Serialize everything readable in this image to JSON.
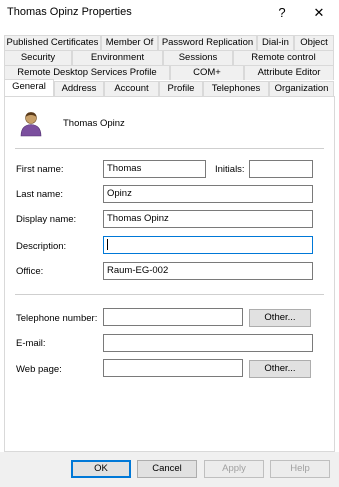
{
  "window": {
    "title": "Thomas Opinz Properties",
    "help_glyph": "?",
    "close_glyph": "✕"
  },
  "tabs": {
    "row1": [
      "Published Certificates",
      "Member Of",
      "Password Replication",
      "Dial-in",
      "Object"
    ],
    "row2": [
      "Security",
      "Environment",
      "Sessions",
      "Remote control"
    ],
    "row3": [
      "Remote Desktop Services Profile",
      "COM+",
      "Attribute Editor"
    ],
    "row4": [
      "General",
      "Address",
      "Account",
      "Profile",
      "Telephones",
      "Organization"
    ],
    "active": "General"
  },
  "general": {
    "user_display": "Thomas Opinz",
    "first_name": {
      "label": "First name:",
      "value": "Thomas"
    },
    "initials": {
      "label": "Initials:",
      "value": ""
    },
    "last_name": {
      "label": "Last name:",
      "value": "Opinz"
    },
    "display_name": {
      "label": "Display name:",
      "value": "Thomas Opinz"
    },
    "description": {
      "label": "Description:",
      "value": ""
    },
    "office": {
      "label": "Office:",
      "value": "Raum-EG-002"
    },
    "telephone": {
      "label": "Telephone number:",
      "value": "",
      "other_label": "Other..."
    },
    "email": {
      "label": "E-mail:",
      "value": ""
    },
    "webpage": {
      "label": "Web page:",
      "value": "",
      "other_label": "Other..."
    }
  },
  "buttons": {
    "ok": "OK",
    "cancel": "Cancel",
    "apply": "Apply",
    "help": "Help"
  },
  "icons": {
    "user": "user-avatar-icon"
  }
}
